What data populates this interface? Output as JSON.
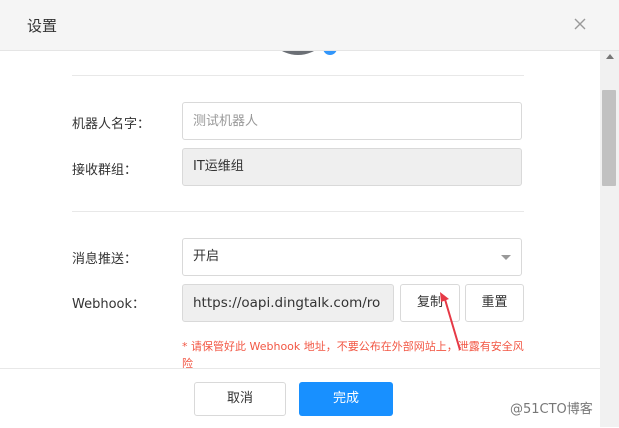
{
  "dialog": {
    "title": "设置",
    "close_icon": "close-icon"
  },
  "form": {
    "robot_name": {
      "label": "机器人名字：",
      "value": "",
      "placeholder": "测试机器人"
    },
    "group": {
      "label": "接收群组：",
      "value": "IT运维组"
    },
    "push": {
      "label": "消息推送：",
      "value": "开启",
      "caret_icon": "caret-down-icon"
    },
    "webhook": {
      "label": "Webhook：",
      "value": "https://oapi.dingtalk.com/ro",
      "copy_label": "复制",
      "reset_label": "重置"
    },
    "warning": "* 请保管好此 Webhook 地址，不要公布在外部网站上，泄露有安全风险"
  },
  "footer": {
    "cancel_label": "取消",
    "done_label": "完成"
  },
  "watermark": "@51CTO博客",
  "colors": {
    "primary": "#1890ff",
    "warning": "#f25643",
    "annotation_arrow": "#e63946"
  }
}
